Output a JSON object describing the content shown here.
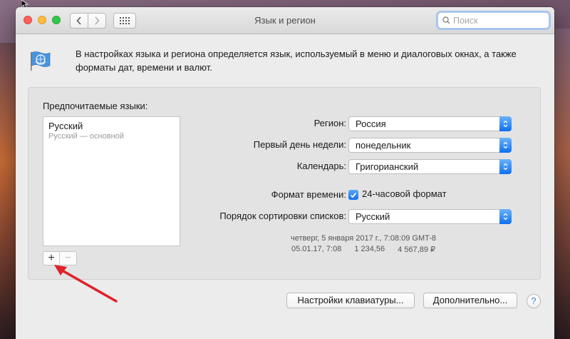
{
  "window": {
    "title": "Язык и регион",
    "search_placeholder": "Поиск"
  },
  "info": {
    "text": "В настройках языка и региона определяется язык, используемый в меню и диалоговых окнах, а также форматы дат, времени и валют."
  },
  "languages": {
    "label": "Предпочитаемые языки:",
    "items": [
      {
        "name": "Русский",
        "subtitle": "Русский — основной"
      }
    ],
    "add_label": "+",
    "remove_label": "−"
  },
  "settings": {
    "region_label": "Регион:",
    "region_value": "Россия",
    "first_day_label": "Первый день недели:",
    "first_day_value": "понедельник",
    "calendar_label": "Календарь:",
    "calendar_value": "Григорианский",
    "time_format_label": "Формат времени:",
    "time_format_checkbox": "24-часовой формат",
    "time_format_checked": true,
    "sort_label": "Порядок сортировки списков:",
    "sort_value": "Русский"
  },
  "sample": {
    "line1": "четверг, 5 января 2017 г., 7:08:09 GMT-8",
    "date_short": "05.01.17, 7:08",
    "number": "1 234,56",
    "currency": "4 567,89 ₽"
  },
  "buttons": {
    "keyboard": "Настройки клавиатуры...",
    "advanced": "Дополнительно...",
    "help": "?"
  },
  "colors": {
    "accent": "#1670f0",
    "annotation_arrow": "#e0202a"
  }
}
